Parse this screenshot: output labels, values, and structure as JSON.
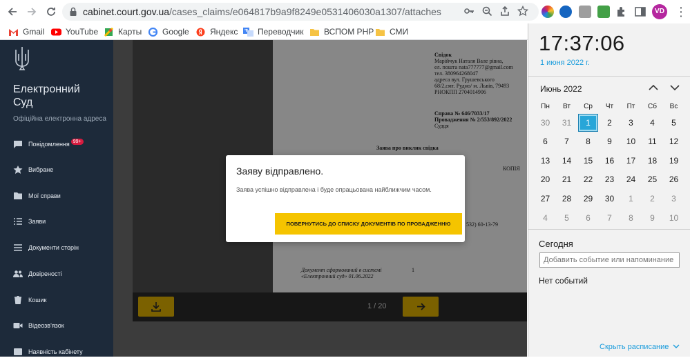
{
  "browser": {
    "url_domain": "cabinet.court.gov.ua",
    "url_path": "/cases_claims/e064817b9a9f8249e0531406030a1307/attaches",
    "avatar_initials": "VD"
  },
  "bookmarks": [
    {
      "label": "Gmail",
      "icon": "gmail-icon"
    },
    {
      "label": "YouTube",
      "icon": "youtube-icon"
    },
    {
      "label": "Карты",
      "icon": "maps-icon"
    },
    {
      "label": "Google",
      "icon": "google-icon"
    },
    {
      "label": "Яндекс",
      "icon": "yandex-icon"
    },
    {
      "label": "Переводчик",
      "icon": "translate-icon"
    },
    {
      "label": "ВСПОМ РНР",
      "icon": "folder-icon"
    },
    {
      "label": "СМИ",
      "icon": "folder-icon"
    }
  ],
  "sidebar": {
    "title": "Електронний Суд",
    "subtitle": "Офіційна електронна адреса",
    "items": [
      {
        "label": "Повідомлення",
        "badge": "99+",
        "icon": "message-icon"
      },
      {
        "label": "Вибране",
        "icon": "star-icon"
      },
      {
        "label": "Мої справи",
        "icon": "folder-icon"
      },
      {
        "label": "Заяви",
        "icon": "list-icon"
      },
      {
        "label": "Документи сторін",
        "icon": "documents-icon"
      },
      {
        "label": "Довіреності",
        "icon": "users-icon"
      },
      {
        "label": "Кошик",
        "icon": "trash-icon"
      },
      {
        "label": "Відеозв'язок",
        "icon": "video-icon"
      },
      {
        "label": "Наявність кабінету",
        "icon": "cabinet-icon"
      }
    ]
  },
  "document": {
    "lines": [
      {
        "text": "Свідок",
        "bold": true
      },
      {
        "text": "Марійчук Наталя Вале рівна,"
      },
      {
        "text": "ел. пошта nata777777@gmail.com"
      },
      {
        "text": "тел. 380964268047"
      },
      {
        "text": "адреса вул. Грушевського"
      },
      {
        "text": "68/2,смт. Рудно/ м. Львів, 79493"
      },
      {
        "text": "РНОКПП 2704014906"
      },
      {
        "text": "Справа № 646/7033/17",
        "bold": true
      },
      {
        "text": "Провадження № 2/553/892/2022",
        "bold": true
      },
      {
        "text": "Судця"
      },
      {
        "text": "Заява про виклик свідка",
        "bold": true
      },
      {
        "text": "КОПІЯ"
      },
      {
        "text": "532) 60-13-79"
      },
      {
        "text": "Документ сформований в системі"
      },
      {
        "text": "«Електронний суд» 01.06.2022"
      },
      {
        "text": "1"
      }
    ],
    "pager": "1 / 20"
  },
  "modal": {
    "title": "Заяву відправлено.",
    "text": "Заява успішно відправлена і буде опрацьована найближчим часом.",
    "button": "ПОВЕРНУТИСЬ ДО СПИСКУ ДОКУМЕНТІВ ПО ПРОВАДЖЕННЮ"
  },
  "calendar": {
    "time": "17:37:06",
    "date": "1 июня 2022 г.",
    "month": "Июнь 2022",
    "weekdays": [
      "Пн",
      "Вт",
      "Ср",
      "Чт",
      "Пт",
      "Сб",
      "Вс"
    ],
    "weeks": [
      [
        "30",
        "31",
        "1",
        "2",
        "3",
        "4",
        "5"
      ],
      [
        "6",
        "7",
        "8",
        "9",
        "10",
        "11",
        "12"
      ],
      [
        "13",
        "14",
        "15",
        "16",
        "17",
        "18",
        "19"
      ],
      [
        "20",
        "21",
        "22",
        "23",
        "24",
        "25",
        "26"
      ],
      [
        "27",
        "28",
        "29",
        "30",
        "1",
        "2",
        "3"
      ],
      [
        "4",
        "5",
        "6",
        "7",
        "8",
        "9",
        "10"
      ]
    ],
    "today_label": "Сегодня",
    "event_placeholder": "Добавить событие или напоминание",
    "no_events": "Нет событий",
    "hide_schedule": "Скрыть расписание"
  }
}
